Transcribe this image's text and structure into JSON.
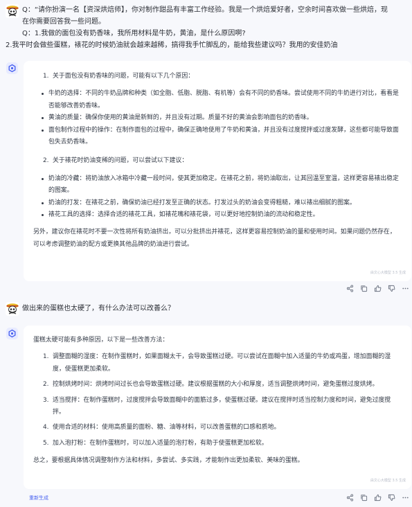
{
  "conversation": {
    "user_1": {
      "lines": [
        "Q：“请你扮演一名【资深烘焙师】，你对制作甜品有丰富工作经验。我是一个烘焙爱好者，空余时间喜欢做一些烘焙，现",
        "在你需要回答我一些问题。",
        "Q：1.我做的面包没有奶香味，我所用材料是牛奶，黄油，是什么原因啊?",
        "2.我平时会做些蛋糕，裱花的时候奶油就会越来越稀，搞得我手忙脚乱的，能给我些建议吗？我用的安佳奶油"
      ]
    },
    "bot_1": {
      "section1_num": "1.",
      "section1_title": "关于面包没有奶香味的问题，可能有以下几个原因：",
      "section1_items": [
        "牛奶的选择：不同的牛奶品牌和种类（如全脂、低脂、脱脂、有机等）会有不同的奶香味。尝试使用不同的牛奶进行对比，看看是否能够改善奶香味。",
        "黄油的质量：确保你使用的黄油是新鲜的，并且没有过期。质量不好的黄油会影响面包的奶香味。",
        "面包制作过程中的操作：在制作面包的过程中，确保正确地使用了牛奶和黄油，并且没有过度搅拌或过度发酵，这些都可能导致面包失去奶香味。"
      ],
      "section2_num": "2.",
      "section2_title": "关于裱花时奶油变稀的问题，可以尝试以下建议：",
      "section2_items": [
        "奶油的冷藏：将奶油放入冰箱中冷藏一段时间，使其更加稳定。在裱花之前，将奶油取出，让其回温至室温，这样更容易裱出稳定的图案。",
        "奶油的打发：在裱花之前，确保奶油已经打发至正确的状态。打发过头的奶油会变得粗糙，难以裱出细腻的图案。",
        "裱花工具的选择：选择合适的裱花工具，如裱花嘴和裱花袋，可以更好地控制奶油的流动和稳定性。"
      ],
      "closing": "另外，建议你在裱花时不要一次性将所有奶油挤出，可以分批挤出并裱花，这样更容易控制奶油的量和使用时间。如果问题仍然存在，可以考虑调整奶油的配方或更换其他品牌的奶油进行尝试。",
      "footer_note": "由文心大模型 3.5 生成"
    },
    "user_2": {
      "text": "做出来的蛋糕也太硬了，有什么办法可以改善么？"
    },
    "bot_2": {
      "intro": "蛋糕太硬可能有多种原因，以下是一些改善方法：",
      "items": [
        {
          "num": "1.",
          "text": "调整面糊的湿度：在制作蛋糕时，如果面糊太干，会导致蛋糕过硬。可以尝试在面糊中加入适量的牛奶或鸡蛋，增加面糊的湿度，使蛋糕更加柔软。"
        },
        {
          "num": "2.",
          "text": "控制烘烤时间：烘烤时间过长也会导致蛋糕过硬。建议根据蛋糕的大小和厚度，适当调整烘烤时间，避免蛋糕过度烘烤。"
        },
        {
          "num": "3.",
          "text": "适当搅拌：在制作蛋糕时，过度搅拌会导致面糊中的面筋过多，使蛋糕过硬。建议在搅拌时适当控制力度和时间，避免过度搅拌。"
        },
        {
          "num": "4.",
          "text": "使用合适的材料：使用高质量的面粉、糖、油等材料，可以改善蛋糕的口感和质地。"
        },
        {
          "num": "5.",
          "text": "加入泡打粉：在制作蛋糕时，可以加入适量的泡打粉，有助于使蛋糕更加松软。"
        }
      ],
      "closing": "总之，要根据具体情况调整制作方法和材料，多尝试、多实践，才能制作出更加柔软、美味的蛋糕。",
      "footer_note": "由文心大模型 3.5 生成"
    },
    "regenerate_label": "重新生成"
  },
  "icons": {
    "user_avatar": "one-piece-skull-avatar-icon",
    "bot_avatar": "ernie-bot-icon",
    "actions": [
      "share-icon",
      "copy-icon",
      "thumbs-up-icon",
      "thumbs-down-icon",
      "more-icon"
    ]
  },
  "colors": {
    "accent": "#4a63f0",
    "bot_icon_bg": "#e8ebff",
    "page_bg": "#f7f8fc",
    "card_bg": "#ffffff"
  }
}
